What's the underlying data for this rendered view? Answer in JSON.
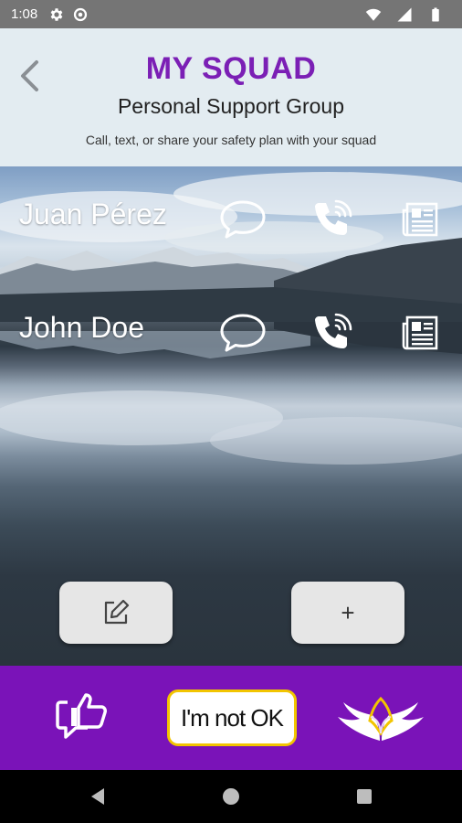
{
  "status_bar": {
    "time": "1:08",
    "icons": [
      "gear-icon",
      "data-saver-icon",
      "wifi-icon",
      "signal-icon",
      "battery-icon"
    ]
  },
  "header": {
    "title": "MY SQUAD",
    "subtitle": "Personal Support Group",
    "helper_text": "Call, text, or share your safety plan with your squad",
    "back_icon": "chevron-left-icon"
  },
  "contacts": [
    {
      "name": "Juan Pérez",
      "actions": [
        "message-icon",
        "phone-icon",
        "safety-plan-icon"
      ]
    },
    {
      "name": "John Doe",
      "actions": [
        "message-icon",
        "phone-icon",
        "safety-plan-icon"
      ]
    }
  ],
  "buttons": {
    "edit_icon": "edit-icon",
    "add_label": "+"
  },
  "bottom_bar": {
    "left_icon": "thumbs-up-chat-icon",
    "not_ok_label": "I'm not OK",
    "right_icon": "wings-logo-icon"
  },
  "colors": {
    "accent_purple": "#7a13b8",
    "title_purple": "#7b1fb5",
    "header_bg": "#e3ecf1",
    "not_ok_border": "#f2c500"
  }
}
